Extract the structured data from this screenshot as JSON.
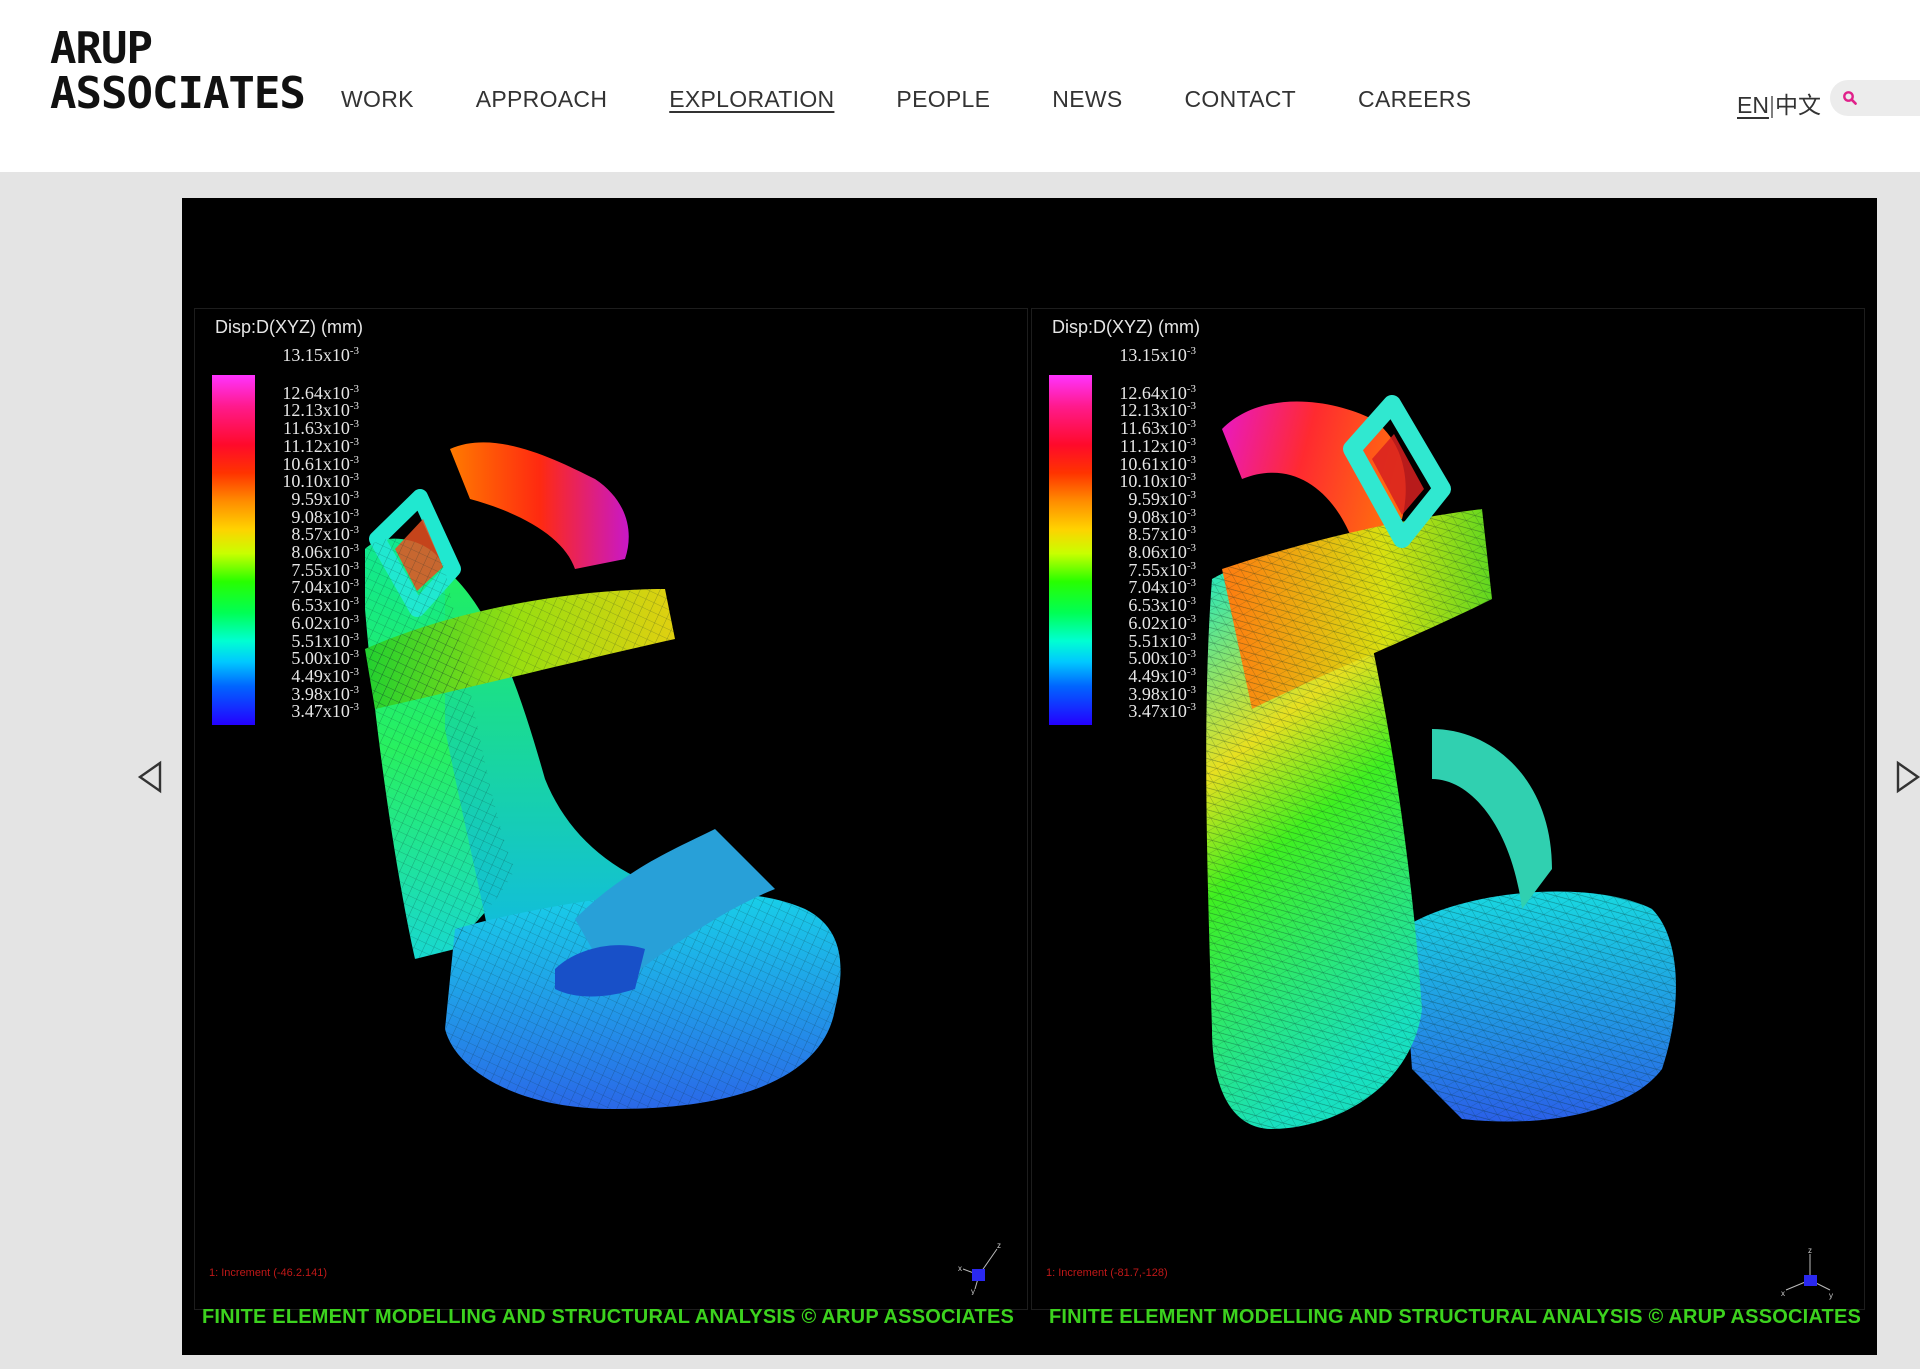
{
  "brand": {
    "line1": "ARUP",
    "line2": "ASSOCIATES"
  },
  "nav": {
    "items": [
      {
        "label": "WORK"
      },
      {
        "label": "APPROACH"
      },
      {
        "label": "EXPLORATION"
      },
      {
        "label": "PEOPLE"
      },
      {
        "label": "NEWS"
      },
      {
        "label": "CONTACT"
      },
      {
        "label": "CAREERS"
      }
    ],
    "active": "EXPLORATION"
  },
  "language": {
    "en": "EN",
    "separator": "|",
    "zh": "中文"
  },
  "search": {
    "placeholder": ""
  },
  "slide": {
    "legend": {
      "title": "Disp:D(XYZ)  (mm)",
      "exponent": "-3",
      "values": [
        "13.15x10",
        "12.64x10",
        "12.13x10",
        "11.63x10",
        "11.12x10",
        "10.61x10",
        "10.10x10",
        "9.59x10",
        "9.08x10",
        "8.57x10",
        "8.06x10",
        "7.55x10",
        "7.04x10",
        "6.53x10",
        "6.02x10",
        "5.51x10",
        "5.00x10",
        "4.49x10",
        "3.98x10",
        "3.47x10"
      ]
    },
    "left_increment": "1: Increment (-46.2.141)",
    "right_increment": "1: Increment (-81.7,-128)",
    "caption": "FINITE ELEMENT MODELLING AND STRUCTURAL ANALYSIS © ARUP ASSOCIATES"
  },
  "colors": {
    "caption": "#3cd21e",
    "search_icon": "#e0218a",
    "background": "#e4e4e4"
  },
  "icons": {
    "prev": "chevron-left-outline",
    "next": "chevron-right-outline",
    "search": "magnifier"
  }
}
